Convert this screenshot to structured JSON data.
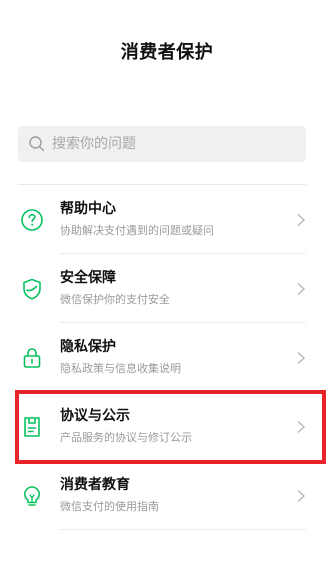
{
  "header": {
    "title": "消费者保护"
  },
  "search": {
    "placeholder": "搜索你的问题",
    "icon": "search-icon"
  },
  "menu": {
    "items": [
      {
        "title": "帮助中心",
        "subtitle": "协助解决支付遇到的问题或疑问",
        "icon": "question-circle-icon"
      },
      {
        "title": "安全保障",
        "subtitle": "微信保护你的支付安全",
        "icon": "shield-check-icon"
      },
      {
        "title": "隐私保护",
        "subtitle": "隐私政策与信息收集说明",
        "icon": "lock-icon"
      },
      {
        "title": "协议与公示",
        "subtitle": "产品服务的协议与修订公示",
        "icon": "document-icon"
      },
      {
        "title": "消费者教育",
        "subtitle": "微信支付的使用指南",
        "icon": "lightbulb-icon"
      }
    ]
  },
  "colors": {
    "accent": "#07c160",
    "highlight": "#e8232a",
    "search_bg": "#f0f0f0"
  }
}
